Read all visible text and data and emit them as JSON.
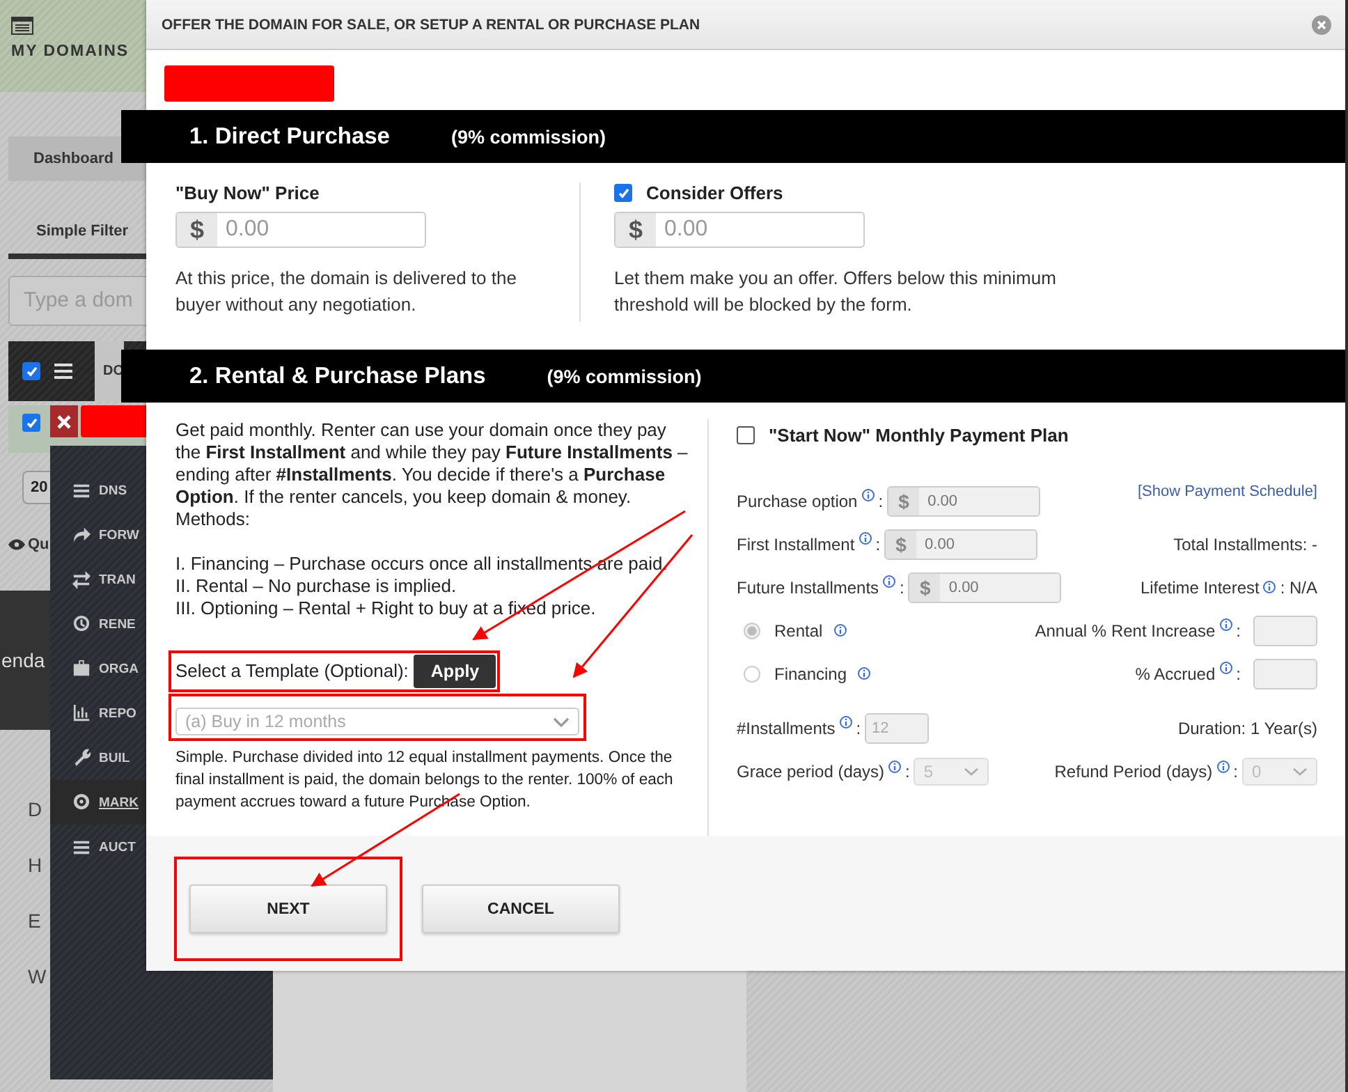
{
  "background_page": {
    "header_title": "MY DOMAINS",
    "dashboard_tab": "Dashboard",
    "filter_tab": "Simple Filter",
    "search": {
      "placeholder": "Type a dom"
    },
    "table_header": {
      "checked": true,
      "column_1": "DO"
    },
    "row": {
      "checked": true
    },
    "page_size": "20",
    "quick_link": "Qu",
    "banner_text": "enda",
    "list_items": [
      "D",
      "H",
      "E",
      "W"
    ]
  },
  "context_menu": {
    "items": [
      {
        "label": "DNS",
        "selected": false
      },
      {
        "label": "FORW",
        "selected": false
      },
      {
        "label": "TRAN",
        "selected": false
      },
      {
        "label": "RENE",
        "selected": false
      },
      {
        "label": "ORGA",
        "selected": false
      },
      {
        "label": "REPO",
        "selected": false
      },
      {
        "label": "BUIL",
        "selected": false
      },
      {
        "label": "MARK",
        "selected": true
      },
      {
        "label": "AUCT",
        "selected": false
      }
    ]
  },
  "modal": {
    "title": "OFFER THE DOMAIN FOR SALE, OR SETUP A RENTAL OR PURCHASE PLAN",
    "section_1": {
      "title": "1. Direct Purchase",
      "note": "(9% commission)"
    },
    "buy_now": {
      "label": "\"Buy Now\" Price",
      "currency": "$",
      "placeholder": "0.00",
      "help": "At this price, the domain is delivered to the buyer without any negotiation."
    },
    "consider_offers": {
      "label": "Consider Offers",
      "checked": true,
      "currency": "$",
      "placeholder": "0.00",
      "help": "Let them make you an offer. Offers below this minimum threshold will be blocked by the form."
    },
    "section_2": {
      "title": "2. Rental & Purchase Plans",
      "note": "(9% commission)"
    },
    "description": "Get paid monthly. Renter can use your domain once they pay the **First Installment** and while they pay **Future Installments** – ending after **#Installments**. You decide if there's a **Purchase Option**. If the renter cancels, you keep domain & money. Methods:",
    "methods": [
      "I. Financing – Purchase occurs once all installments are paid.",
      "II. Rental – No purchase is implied.",
      "III. Optioning – Rental + Right to buy at a fixed price."
    ],
    "template": {
      "label": "Select a Template (Optional):",
      "apply": "Apply",
      "value": "(a) Buy in 12 months",
      "description": "Simple. Purchase divided into 12 equal installment payments. Once the final installment is paid, the domain belongs to the renter. 100% of each payment accrues toward a future Purchase Option."
    },
    "plan": {
      "label": "\"Start Now\" Monthly Payment Plan",
      "checked": false,
      "disabled": true,
      "purchase_option": {
        "label": "Purchase option",
        "separator": ":",
        "currency": "$",
        "placeholder": "0.00"
      },
      "schedule_link": "[Show Payment Schedule]",
      "first_installment": {
        "label": "First Installment",
        "separator": ":",
        "currency": "$",
        "placeholder": "0.00"
      },
      "total_installments": "Total Installments: -",
      "future_installments": {
        "label": "Future Installments",
        "separator": ":",
        "currency": "$",
        "placeholder": "0.00"
      },
      "lifetime_interest": {
        "label": "Lifetime Interest",
        "value": ": N/A"
      },
      "methods": [
        {
          "label": "Rental",
          "selected": true
        },
        {
          "label": "Financing",
          "selected": false
        }
      ],
      "rent_increase": {
        "label": "Annual % Rent Increase",
        "separator": ":"
      },
      "accrued": {
        "label": "% Accrued",
        "separator": ":"
      },
      "installments": {
        "label": "#Installments",
        "separator": ":",
        "value": "12"
      },
      "duration": "Duration: 1 Year(s)",
      "grace_period": {
        "label": "Grace period (days)",
        "separator": ":",
        "value": "5"
      },
      "refund_period": {
        "label": "Refund Period (days)",
        "separator": ":",
        "value": "0"
      }
    },
    "buttons": [
      "NEXT",
      "CANCEL"
    ]
  }
}
